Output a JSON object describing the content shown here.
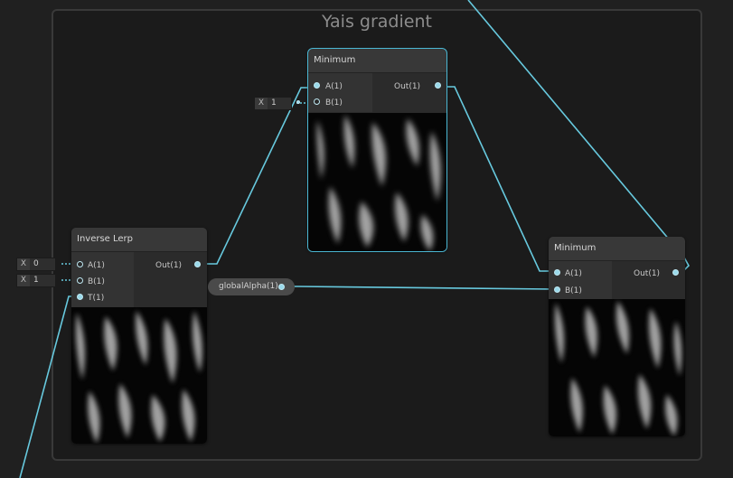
{
  "group": {
    "title": "Yais gradient"
  },
  "nodes": {
    "minimum_top": {
      "title": "Minimum",
      "input_a": "A(1)",
      "input_b": "B(1)",
      "output": "Out(1)",
      "field_b": {
        "axis": "X",
        "value": "1"
      }
    },
    "inverse_lerp": {
      "title": "Inverse Lerp",
      "input_a": "A(1)",
      "input_b": "B(1)",
      "input_t": "T(1)",
      "output": "Out(1)",
      "field_a": {
        "axis": "X",
        "value": "0"
      },
      "field_b": {
        "axis": "X",
        "value": "1"
      }
    },
    "minimum_right": {
      "title": "Minimum",
      "input_a": "A(1)",
      "input_b": "B(1)",
      "output": "Out(1)"
    }
  },
  "property": {
    "label": "globalAlpha(1)"
  },
  "colors": {
    "wire": "#67c9de",
    "selection": "#4bb8d4",
    "background": "#202020",
    "group_fill": "#1b1b1b"
  }
}
